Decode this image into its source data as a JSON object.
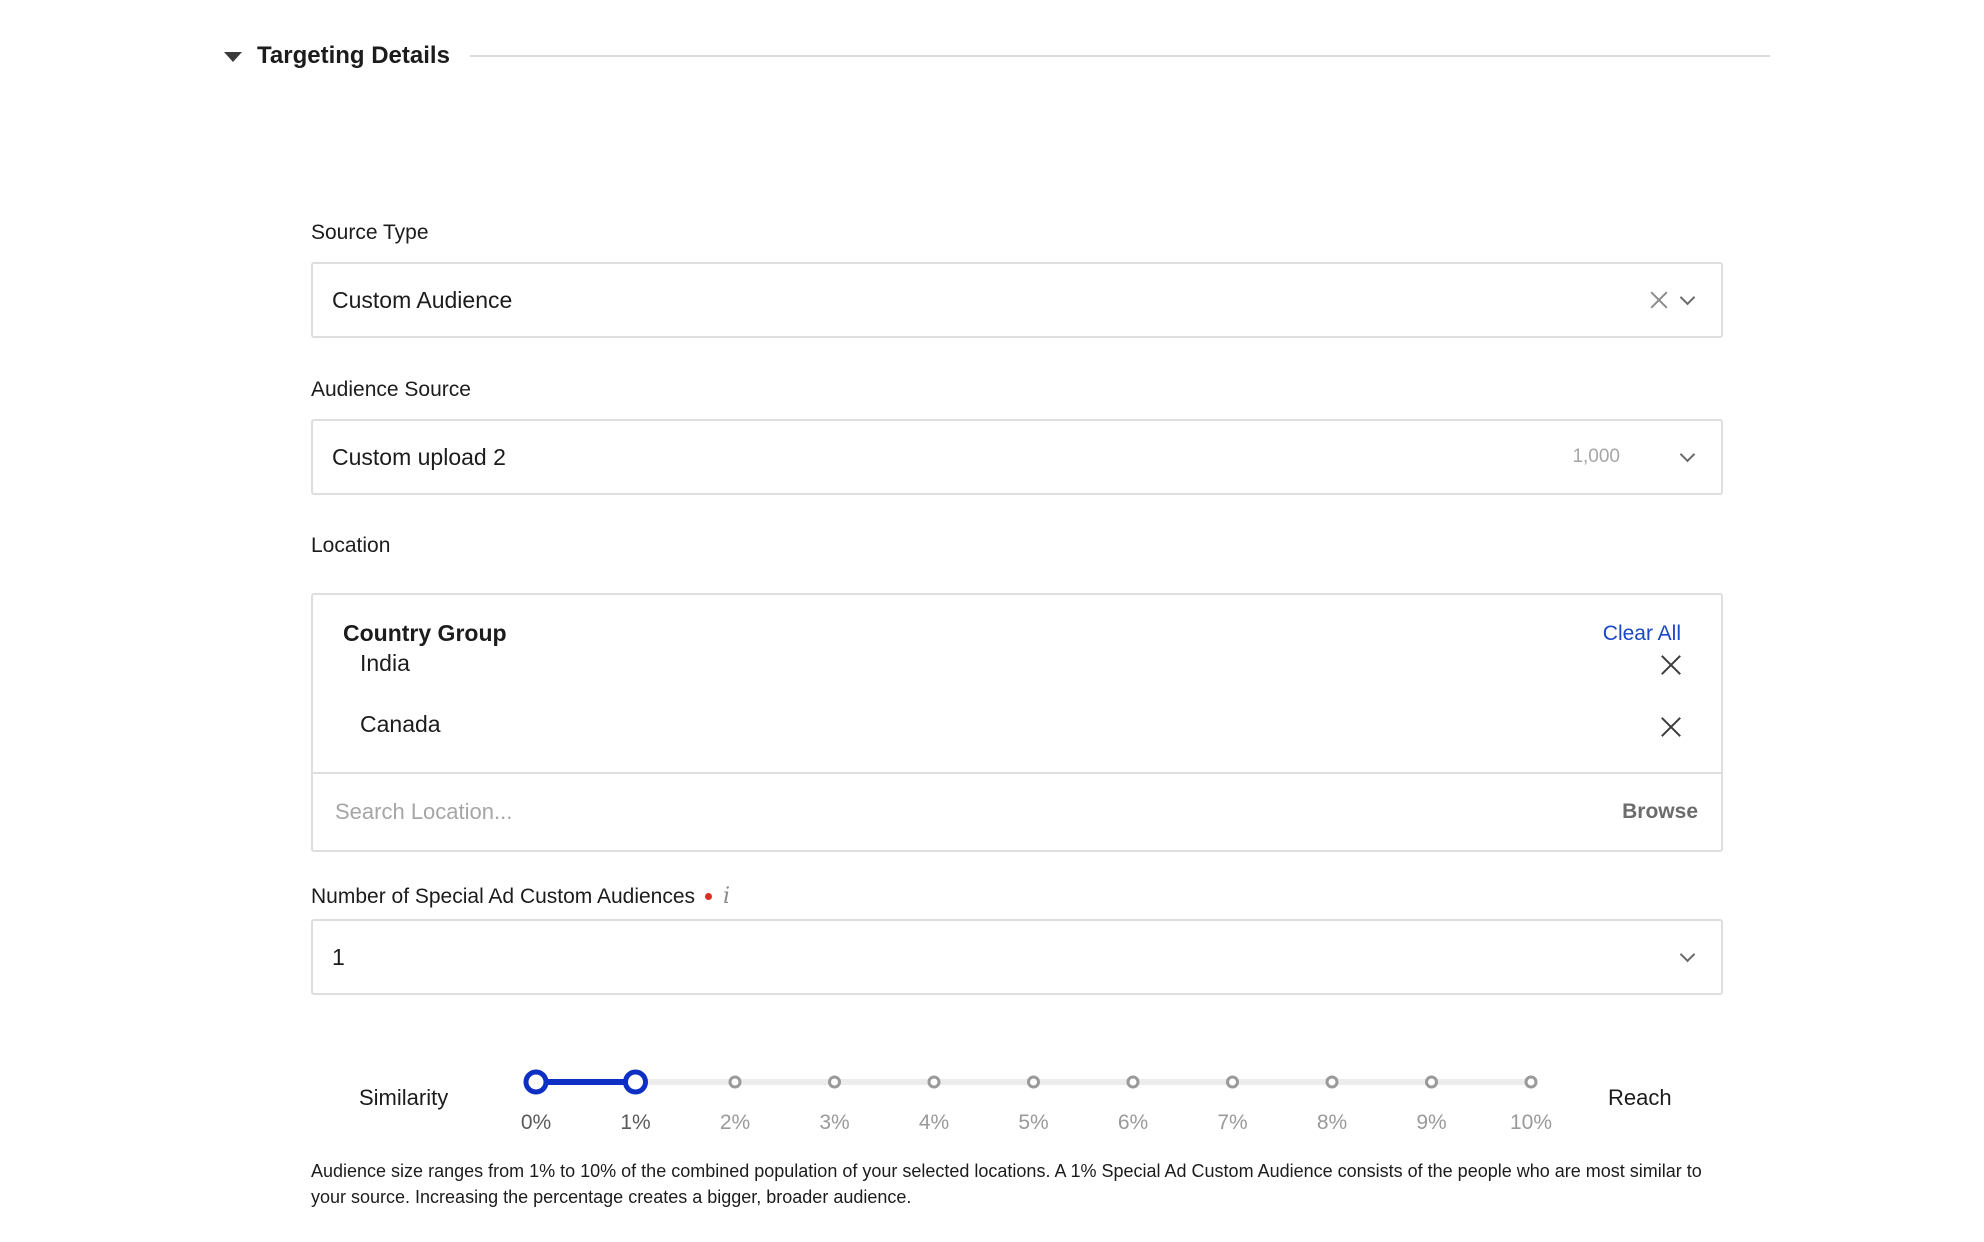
{
  "section": {
    "title": "Targeting Details",
    "icon": "caret-down-icon"
  },
  "source_type": {
    "label": "Source Type",
    "value": "Custom Audience"
  },
  "audience_source": {
    "label": "Audience Source",
    "value": "Custom upload 2",
    "count": "1,000"
  },
  "location": {
    "label": "Location",
    "group_title": "Country Group",
    "clear_all": "Clear All",
    "items": [
      "India",
      "Canada"
    ],
    "search_placeholder": "Search Location...",
    "browse": "Browse"
  },
  "num_audiences": {
    "label": "Number of Special Ad Custom Audiences",
    "info": "i",
    "value": "1"
  },
  "slider": {
    "left_label": "Similarity",
    "right_label": "Reach",
    "ticks": [
      "0%",
      "1%",
      "2%",
      "3%",
      "4%",
      "5%",
      "6%",
      "7%",
      "8%",
      "9%",
      "10%"
    ],
    "range_start": 0,
    "range_end": 1,
    "active_color": "#0d2fc4",
    "inactive_color": "#9a9a9a"
  },
  "help_text": "Audience size ranges from 1% to 10% of the combined population of your selected locations. A 1% Special Ad Custom Audience consists of the people who are most similar to your source. Increasing the percentage creates a bigger, broader audience."
}
